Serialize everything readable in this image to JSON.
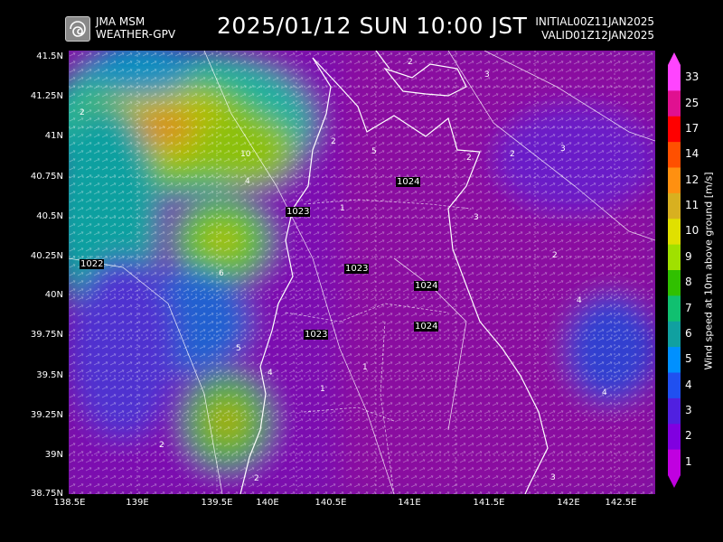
{
  "header": {
    "org_line1": "JMA MSM",
    "org_line2": "WEATHER-GPV",
    "title": "2025/01/12 SUN 10:00 JST",
    "initial": "INITIAL00Z11JAN2025",
    "valid": "VALID01Z12JAN2025"
  },
  "icons": {
    "logo": "swirl-logo-icon"
  },
  "colorbar": {
    "title": "Wind speed at 10m above ground [m/s]",
    "levels": [
      "33",
      "25",
      "17",
      "14",
      "12",
      "11",
      "10",
      "9",
      "8",
      "7",
      "6",
      "5",
      "4",
      "3",
      "2",
      "1"
    ],
    "colors": [
      "#ff44ff",
      "#e01090",
      "#ff0000",
      "#ff5000",
      "#ff9010",
      "#d8b020",
      "#e0e000",
      "#a0e000",
      "#30c000",
      "#10c070",
      "#10a0a0",
      "#0090ff",
      "#2050f0",
      "#5020e0",
      "#8000e0",
      "#c000e0"
    ]
  },
  "axes": {
    "lat_labels": [
      "41.5N",
      "41.25N",
      "41N",
      "40.75N",
      "40.5N",
      "40.25N",
      "40N",
      "39.75N",
      "39.5N",
      "39.25N",
      "39N",
      "38.75N"
    ],
    "lon_labels": [
      "138.5E",
      "139E",
      "139.5E",
      "140E",
      "140.5E",
      "141E",
      "141.5E",
      "142E",
      "142.5E"
    ]
  },
  "pressure_labels": [
    "1024",
    "1023",
    "1023",
    "1024",
    "1024",
    "1022",
    "1023"
  ],
  "wind_labels": [
    "2",
    "2",
    "3",
    "2",
    "2",
    "3",
    "2",
    "3",
    "2",
    "1",
    "1",
    "2",
    "4",
    "4",
    "3",
    "2",
    "1",
    "4",
    "5",
    "6",
    "10",
    "5",
    "4"
  ]
}
